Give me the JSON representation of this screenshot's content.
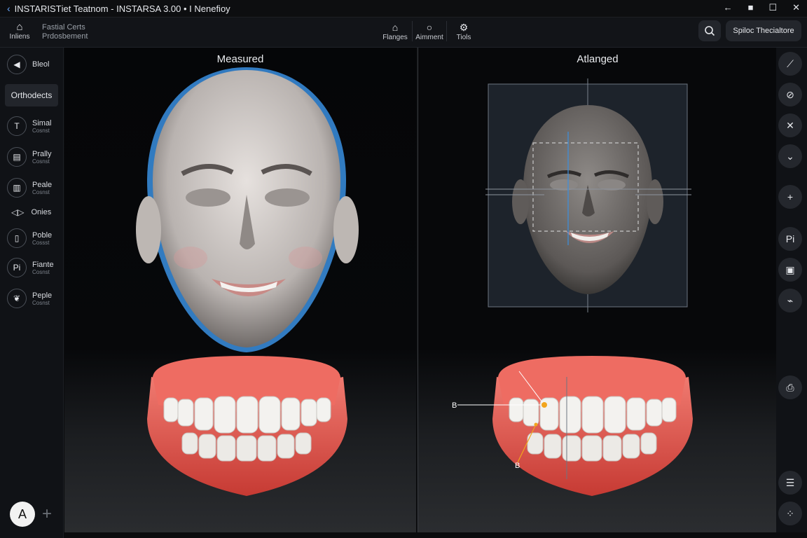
{
  "window": {
    "back_icon": "chevron-left-icon",
    "title": "INSTARISТiet Teatnom - INSTARSA 3.00 • I Nenefioy",
    "controls": [
      "back-arrow-icon",
      "pin-icon",
      "maximize-icon",
      "close-icon"
    ]
  },
  "toolbar": {
    "home_label": "Inliens",
    "breadcrumb_line1": "Fastial Certs",
    "breadcrumb_line2": "Prdosbement",
    "center_items": [
      {
        "label": "Flanges",
        "icon": "home-icon"
      },
      {
        "label": "Aimment",
        "icon": "circle-icon"
      },
      {
        "label": "Tiols",
        "icon": "gear-icon"
      }
    ],
    "search_icon": "search-icon",
    "right_button": "Spiloc Thecialtore"
  },
  "sidebar": {
    "items": [
      {
        "label": "Bleol",
        "sub": "",
        "icon": "play-icon"
      },
      {
        "label": "Orthodects",
        "sub": "",
        "icon": ""
      },
      {
        "label": "Simal",
        "sub": "Cosnst",
        "icon": "t-icon"
      },
      {
        "label": "Prally",
        "sub": "Cosnst",
        "icon": "doc-icon"
      },
      {
        "label": "Peale",
        "sub": "Cosnst",
        "icon": "chart-icon"
      },
      {
        "label": "Onies",
        "sub": "",
        "icon": "eye-icon"
      },
      {
        "label": "Poble",
        "sub": "Cossst",
        "icon": "page-icon"
      },
      {
        "label": "Fiante",
        "sub": "Cosnst",
        "icon": "pi-icon"
      },
      {
        "label": "Peple",
        "sub": "Cosnst",
        "icon": "leaf-icon"
      }
    ],
    "avatar_letter": "A"
  },
  "viewports": {
    "left_title": "Measured",
    "right_title": "Atlanged",
    "annotation_b1": "B",
    "annotation_b2": "B"
  },
  "colors": {
    "accent_blue": "#3a8fe0",
    "gum": "#e0584f",
    "marker": "#f2a51d"
  },
  "rightbar": {
    "icons": [
      "trend-icon",
      "link-icon",
      "close-icon",
      "chevron-down-icon",
      "plus-icon",
      "pi-icon",
      "image-icon",
      "link-icon",
      "capture-icon",
      "list-icon",
      "grid-icon"
    ]
  }
}
